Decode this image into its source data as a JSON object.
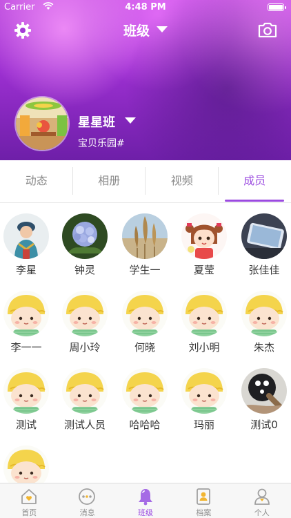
{
  "status_bar": {
    "carrier": "Carrier",
    "time": "4:48 PM"
  },
  "header": {
    "title": "班级",
    "class_name": "星星班",
    "school_name": "宝贝乐园#"
  },
  "tabs": [
    {
      "label": "动态",
      "active": false
    },
    {
      "label": "相册",
      "active": false
    },
    {
      "label": "视频",
      "active": false
    },
    {
      "label": "成员",
      "active": true
    }
  ],
  "members": [
    {
      "name": "李星",
      "avatar": "child-photo"
    },
    {
      "name": "钟灵",
      "avatar": "flower-photo"
    },
    {
      "name": "学生一",
      "avatar": "grass-photo"
    },
    {
      "name": "夏莹",
      "avatar": "girl-cartoon"
    },
    {
      "name": "张佳佳",
      "avatar": "phone-photo"
    },
    {
      "name": "李一一",
      "avatar": "default-cartoon"
    },
    {
      "name": "周小玲",
      "avatar": "default-cartoon"
    },
    {
      "name": "何晓",
      "avatar": "default-cartoon"
    },
    {
      "name": "刘小明",
      "avatar": "default-cartoon"
    },
    {
      "name": "朱杰",
      "avatar": "default-cartoon"
    },
    {
      "name": "测试",
      "avatar": "default-cartoon"
    },
    {
      "name": "测试人员",
      "avatar": "default-cartoon"
    },
    {
      "name": "哈哈哈",
      "avatar": "default-cartoon"
    },
    {
      "name": "玛丽",
      "avatar": "default-cartoon"
    },
    {
      "name": "测试0",
      "avatar": "object-photo"
    },
    {
      "name": "",
      "avatar": "default-cartoon"
    }
  ],
  "tabbar": [
    {
      "label": "首页",
      "icon": "home-icon",
      "active": false
    },
    {
      "label": "消息",
      "icon": "chat-icon",
      "active": false
    },
    {
      "label": "班级",
      "icon": "bell-icon",
      "active": true
    },
    {
      "label": "档案",
      "icon": "profile-card-icon",
      "active": false
    },
    {
      "label": "个人",
      "icon": "person-icon",
      "active": false
    }
  ],
  "colors": {
    "accent": "#9b4be0",
    "header_purple": "#9b2fd0"
  }
}
